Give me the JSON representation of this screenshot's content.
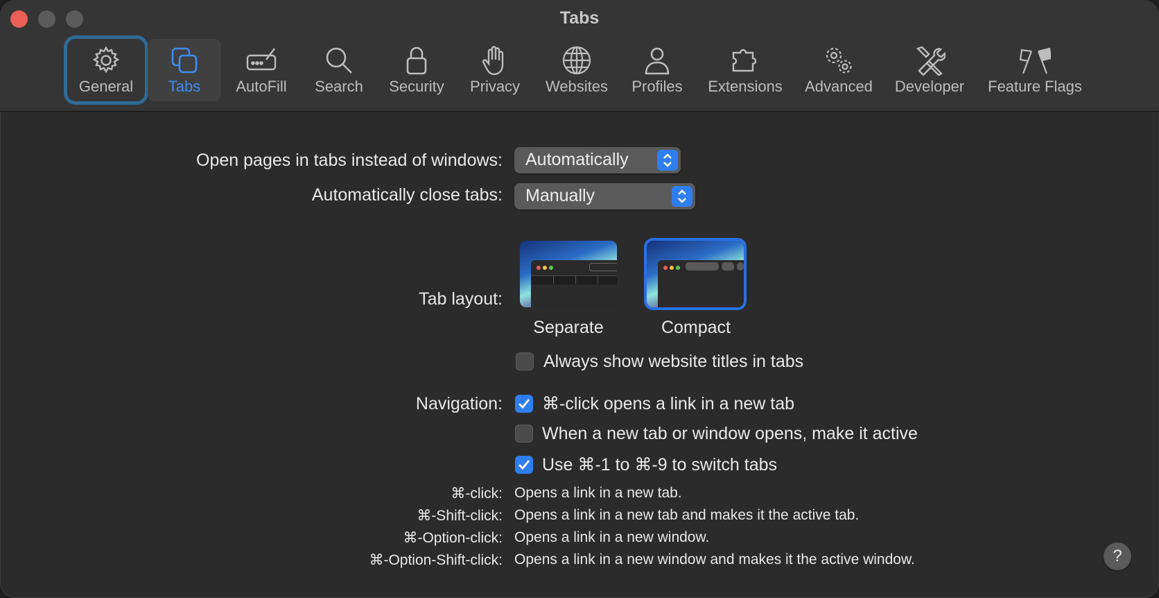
{
  "window": {
    "title": "Tabs"
  },
  "toolbar": {
    "tabs": [
      {
        "label": "General",
        "icon": "gear-icon"
      },
      {
        "label": "Tabs",
        "icon": "tabs-icon"
      },
      {
        "label": "AutoFill",
        "icon": "autofill-icon"
      },
      {
        "label": "Search",
        "icon": "search-icon"
      },
      {
        "label": "Security",
        "icon": "lock-icon"
      },
      {
        "label": "Privacy",
        "icon": "hand-icon"
      },
      {
        "label": "Websites",
        "icon": "globe-icon"
      },
      {
        "label": "Profiles",
        "icon": "person-icon"
      },
      {
        "label": "Extensions",
        "icon": "puzzle-icon"
      },
      {
        "label": "Advanced",
        "icon": "gears-icon"
      },
      {
        "label": "Developer",
        "icon": "tools-icon"
      },
      {
        "label": "Feature Flags",
        "icon": "flags-icon"
      }
    ],
    "selected": "Tabs",
    "focused": "General"
  },
  "settings": {
    "open_pages_label": "Open pages in tabs instead of windows:",
    "open_pages_value": "Automatically",
    "close_tabs_label": "Automatically close tabs:",
    "close_tabs_value": "Manually",
    "tab_layout_label": "Tab layout:",
    "layout_separate": "Separate",
    "layout_compact": "Compact",
    "layout_selected": "Compact",
    "always_titles_label": "Always show website titles in tabs",
    "always_titles_checked": false,
    "navigation_label": "Navigation:",
    "nav_options": [
      {
        "label": "⌘-click opens a link in a new tab",
        "checked": true
      },
      {
        "label": "When a new tab or window opens, make it active",
        "checked": false
      },
      {
        "label": "Use ⌘-1 to ⌘-9 to switch tabs",
        "checked": true
      }
    ]
  },
  "help_table": [
    {
      "key": "⌘-click:",
      "value": "Opens a link in a new tab."
    },
    {
      "key": "⌘-Shift-click:",
      "value": "Opens a link in a new tab and makes it the active tab."
    },
    {
      "key": "⌘-Option-click:",
      "value": "Opens a link in a new window."
    },
    {
      "key": "⌘-Option-Shift-click:",
      "value": "Opens a link in a new window and makes it the active window."
    }
  ],
  "help_button": {
    "label": "?"
  },
  "colors": {
    "accent": "#2f7ef0",
    "selected_tab_text": "#3d8cf1",
    "focus_ring": "#2e6a95"
  }
}
